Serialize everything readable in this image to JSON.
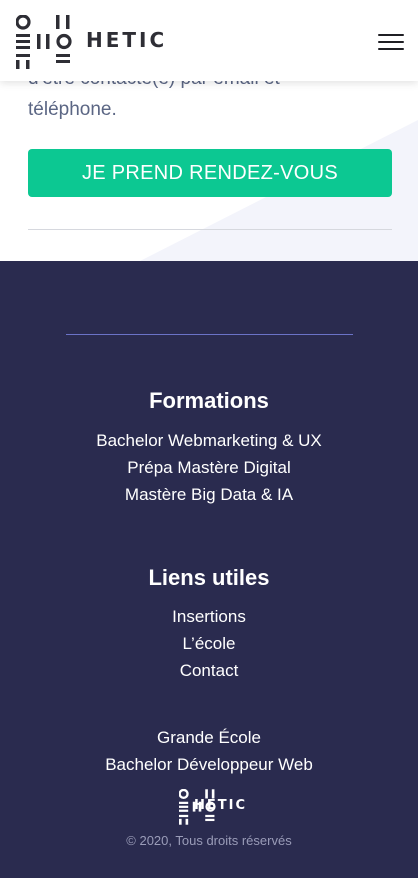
{
  "header": {
    "logo_text": "HETIC",
    "menu_icon": "hamburger-menu-icon"
  },
  "content": {
    "partial_text_line1": "d'être contacté(e) par email et",
    "partial_text_line2": "téléphone.",
    "cta_label": "JE PREND RENDEZ-VOUS",
    "cta_color": "#0cc892"
  },
  "footer": {
    "background": "#2a2b4f",
    "formations": {
      "heading": "Formations",
      "links": [
        "Bachelor Webmarketing & UX",
        "Prépa Mastère Digital",
        "Mastère Big Data & IA"
      ]
    },
    "liens": {
      "heading": "Liens utiles",
      "links": [
        "Insertions",
        "L’école",
        "Contact"
      ]
    },
    "extra_links": [
      "Grande École",
      "Bachelor Développeur Web"
    ],
    "logo_text": "HETIC",
    "copyright": "© 2020, Tous droits réservés"
  }
}
